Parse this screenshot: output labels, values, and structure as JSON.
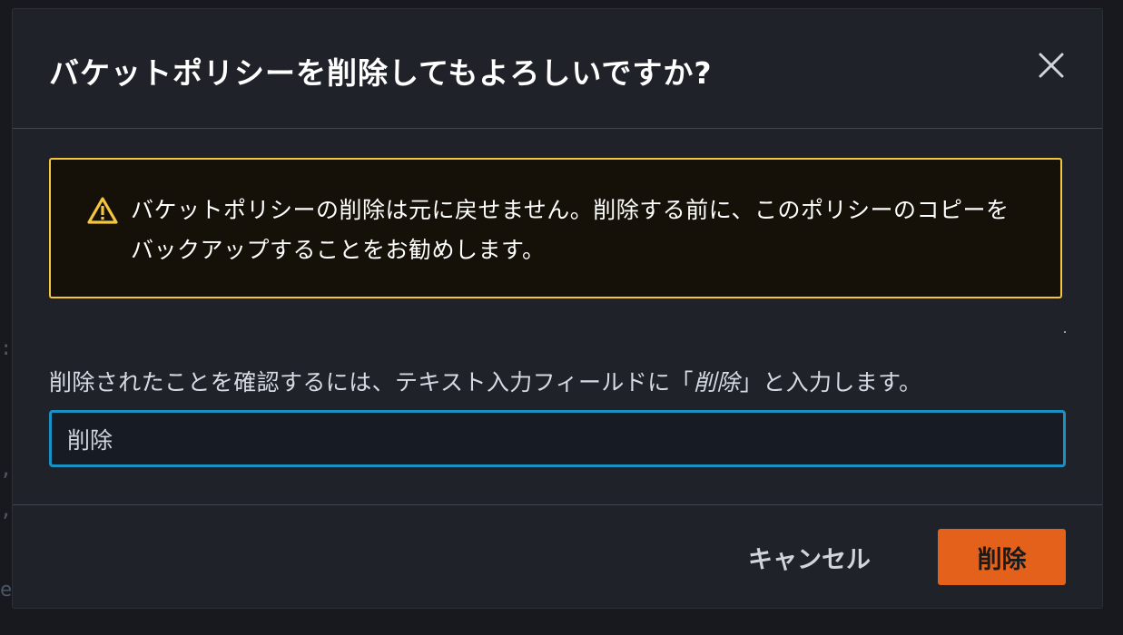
{
  "modal": {
    "title": "バケットポリシーを削除してもよろしいですか?",
    "close_icon": "close-icon"
  },
  "alert": {
    "icon": "warning-icon",
    "message": "バケットポリシーの削除は元に戻せません。削除する前に、このポリシーのコピーをバックアップすることをお勧めします。",
    "border_color": "#f4c53d"
  },
  "confirm": {
    "label_prefix": "削除されたことを確認するには、テキスト入力フィールドに「",
    "label_keyword": "削除",
    "label_suffix": "」と入力します。",
    "input_value": "削除"
  },
  "footer": {
    "cancel_label": "キャンセル",
    "delete_label": "削除",
    "delete_color": "#e3611b"
  }
}
